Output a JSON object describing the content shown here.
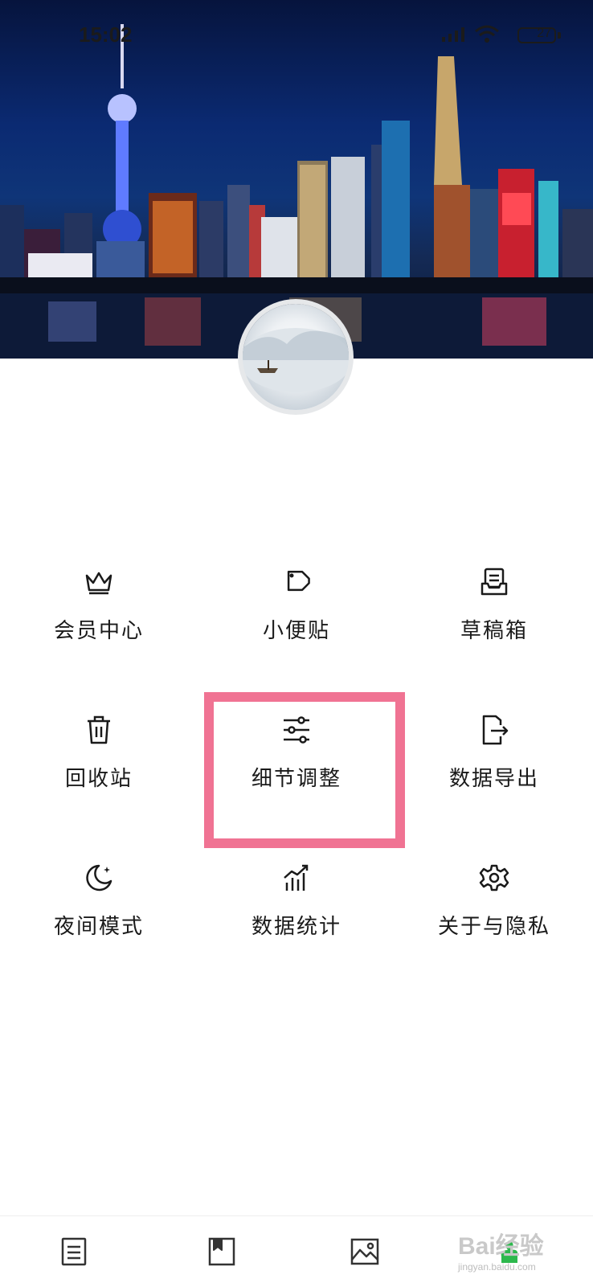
{
  "status_bar": {
    "time": "15:02",
    "battery": "27"
  },
  "menu": {
    "items": [
      {
        "label": "会员中心",
        "icon": "crown-icon"
      },
      {
        "label": "小便贴",
        "icon": "tag-icon"
      },
      {
        "label": "草稿箱",
        "icon": "drafts-icon"
      },
      {
        "label": "回收站",
        "icon": "trash-icon"
      },
      {
        "label": "细节调整",
        "icon": "sliders-icon"
      },
      {
        "label": "数据导出",
        "icon": "export-icon"
      },
      {
        "label": "夜间模式",
        "icon": "moon-icon"
      },
      {
        "label": "数据统计",
        "icon": "stats-icon"
      },
      {
        "label": "关于与隐私",
        "icon": "gear-icon"
      }
    ]
  },
  "bottom_nav": {
    "items": [
      {
        "icon": "notes-icon"
      },
      {
        "icon": "bookmark-icon"
      },
      {
        "icon": "image-icon"
      },
      {
        "icon": "profile-icon"
      }
    ]
  },
  "watermark": {
    "text": "Bai经验",
    "sub": "jingyan.baidu.com"
  },
  "colors": {
    "highlight": "#f07393",
    "accent": "#2db84d"
  }
}
